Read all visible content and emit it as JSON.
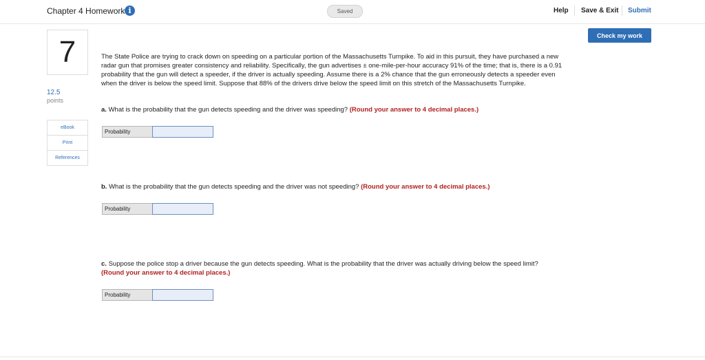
{
  "header": {
    "title": "Chapter 4 Homework",
    "info_icon": "i",
    "status": "Saved",
    "links": {
      "help": "Help",
      "save_exit": "Save & Exit",
      "submit": "Submit"
    },
    "check_button": "Check my work"
  },
  "question": {
    "number": "7",
    "points_value": "12.5",
    "points_label": "points",
    "tools": [
      "eBook",
      "Print",
      "References"
    ]
  },
  "prompt": "The State Police are trying to crack down on speeding on a particular portion of the Massachusetts Turnpike. To aid in this pursuit, they have purchased a new radar gun that promises greater consistency and reliability. Specifically, the gun advertises ± one-mile-per-hour accuracy 91% of the time; that is, there is a 0.91 probability that the gun will detect a speeder, if the driver is actually speeding. Assume there is a 2% chance that the gun erroneously detects a speeder even when the driver is below the speed limit. Suppose that 88% of the drivers drive below the speed limit on this stretch of the Massachusetts Turnpike.",
  "parts": [
    {
      "letter": "a.",
      "text": " What is the probability that the gun detects speeding and the driver was speeding? ",
      "instruction": "(Round your answer to 4 decimal places.)",
      "answer_label": "Probability",
      "answer_value": ""
    },
    {
      "letter": "b.",
      "text": " What is the probability that the gun detects speeding and the driver was not speeding? ",
      "instruction": "(Round your answer to 4 decimal places.)",
      "answer_label": "Probability",
      "answer_value": ""
    },
    {
      "letter": "c.",
      "text": " Suppose the police stop a driver because the gun detects speeding. What is the probability that the driver was actually driving below the speed limit? ",
      "instruction": "(Round your answer to 4 decimal places.)",
      "answer_label": "Probability",
      "answer_value": ""
    }
  ],
  "colors": {
    "accent": "#2f6eb5",
    "instruction_red": "#b21f1f"
  }
}
